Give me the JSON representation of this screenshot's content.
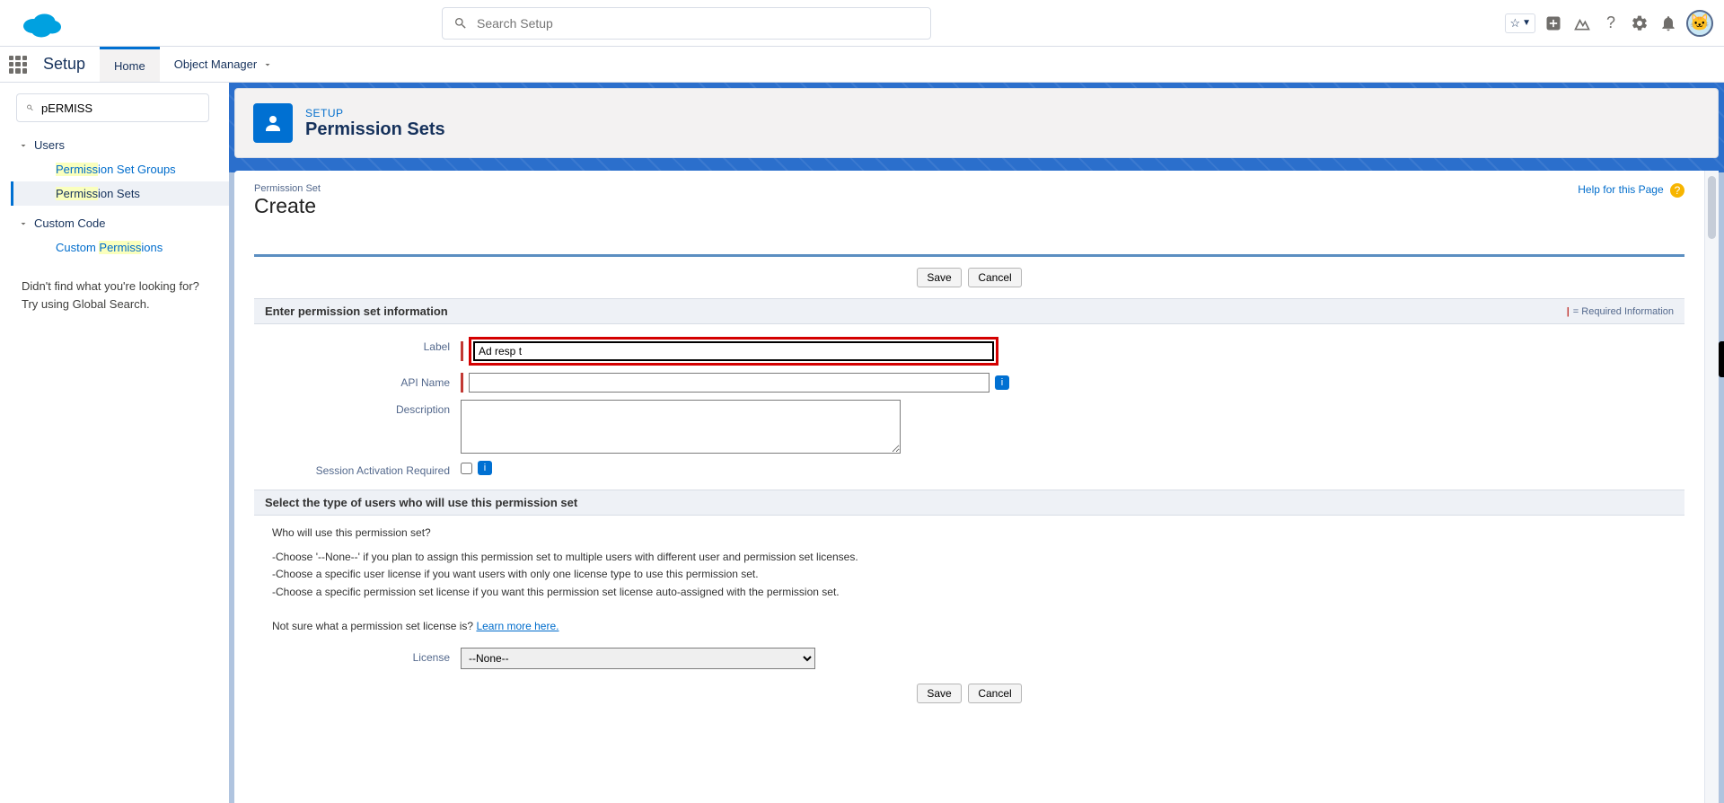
{
  "globalSearch": {
    "placeholder": "Search Setup"
  },
  "contextBar": {
    "appName": "Setup",
    "home": "Home",
    "objectManager": "Object Manager"
  },
  "sidebar": {
    "quickFind": "pERMISS",
    "sections": [
      {
        "label": "Users",
        "items": [
          {
            "text_pre": "Permiss",
            "text_post": "ion Set Groups",
            "selected": false
          },
          {
            "text_pre": "Permiss",
            "text_post": "ion Sets",
            "selected": true
          }
        ]
      },
      {
        "label": "Custom Code",
        "items": [
          {
            "text_pre_plain": "Custom ",
            "text_hl": "Permiss",
            "text_post": "ions",
            "selected": false
          }
        ]
      }
    ],
    "noResults1": "Didn't find what you're looking for?",
    "noResults2": "Try using Global Search."
  },
  "pageHeader": {
    "breadcrumb": "SETUP",
    "title": "Permission Sets"
  },
  "entity": {
    "label": "Permission Set",
    "title": "Create",
    "helpLink": "Help for this Page"
  },
  "buttons": {
    "save": "Save",
    "cancel": "Cancel"
  },
  "section1": {
    "header": "Enter permission set information",
    "reqInfo": "= Required Information"
  },
  "form": {
    "labelLabel": "Label",
    "labelValue": "Ad resp t",
    "apiLabel": "API Name",
    "apiValue": "",
    "descLabel": "Description",
    "descValue": "",
    "sessionLabel": "Session Activation Required"
  },
  "section2": {
    "header": "Select the type of users who will use this permission set"
  },
  "helpText": {
    "q": "Who will use this permission set?",
    "l1": "-Choose '--None--' if you plan to assign this permission set to multiple users with different user and permission set licenses.",
    "l2": "-Choose a specific user license if you want users with only one license type to use this permission set.",
    "l3": "-Choose a specific permission set license if you want this permission set license auto-assigned with the permission set.",
    "notSure": "Not sure what a permission set license is? ",
    "learnMore": "Learn more here.",
    "licenseLabel": "License",
    "licenseValue": "--None--"
  }
}
